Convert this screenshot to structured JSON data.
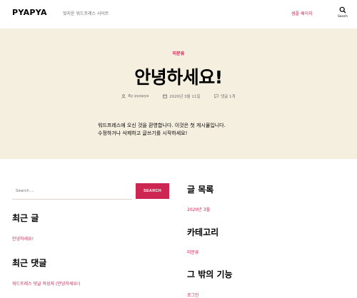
{
  "header": {
    "site_title": "PYAPYA",
    "site_description": "멋지운 워드프레스 사이트",
    "nav_link": "샘플 페이지",
    "search_label": "Search"
  },
  "hero": {
    "category": "미분류",
    "title": "안녕하세요!",
    "author": "By pyapya",
    "date": "2020년 3월 11일",
    "comments": "댓글 1개",
    "excerpt_line1": "워드프레스에 오신 것을 환영합니다. 이것은 첫 게시물입니다.",
    "excerpt_line2": "수정하거나 삭제하고 글쓰기를 시작하세요!"
  },
  "widgets": {
    "search_placeholder": "Search ...",
    "search_button": "SEARCH",
    "recent_posts_title": "최근 글",
    "recent_post_1": "안녕하세요!",
    "recent_comments_title": "최근 댓글",
    "recent_comment_author": "워드프레스 댓글 작성자",
    "recent_comment_on": "(안녕하세요!)",
    "archives_title": "글 목록",
    "archive_1": "2020년 3월",
    "categories_title": "카테고리",
    "category_1": "미분류",
    "meta_title": "그 밖의 기능",
    "meta_link_1": "로그인"
  },
  "colors": {
    "accent": "#cd2653",
    "hero_bg": "#f5efe0",
    "muted_text": "#6d6d6d"
  }
}
